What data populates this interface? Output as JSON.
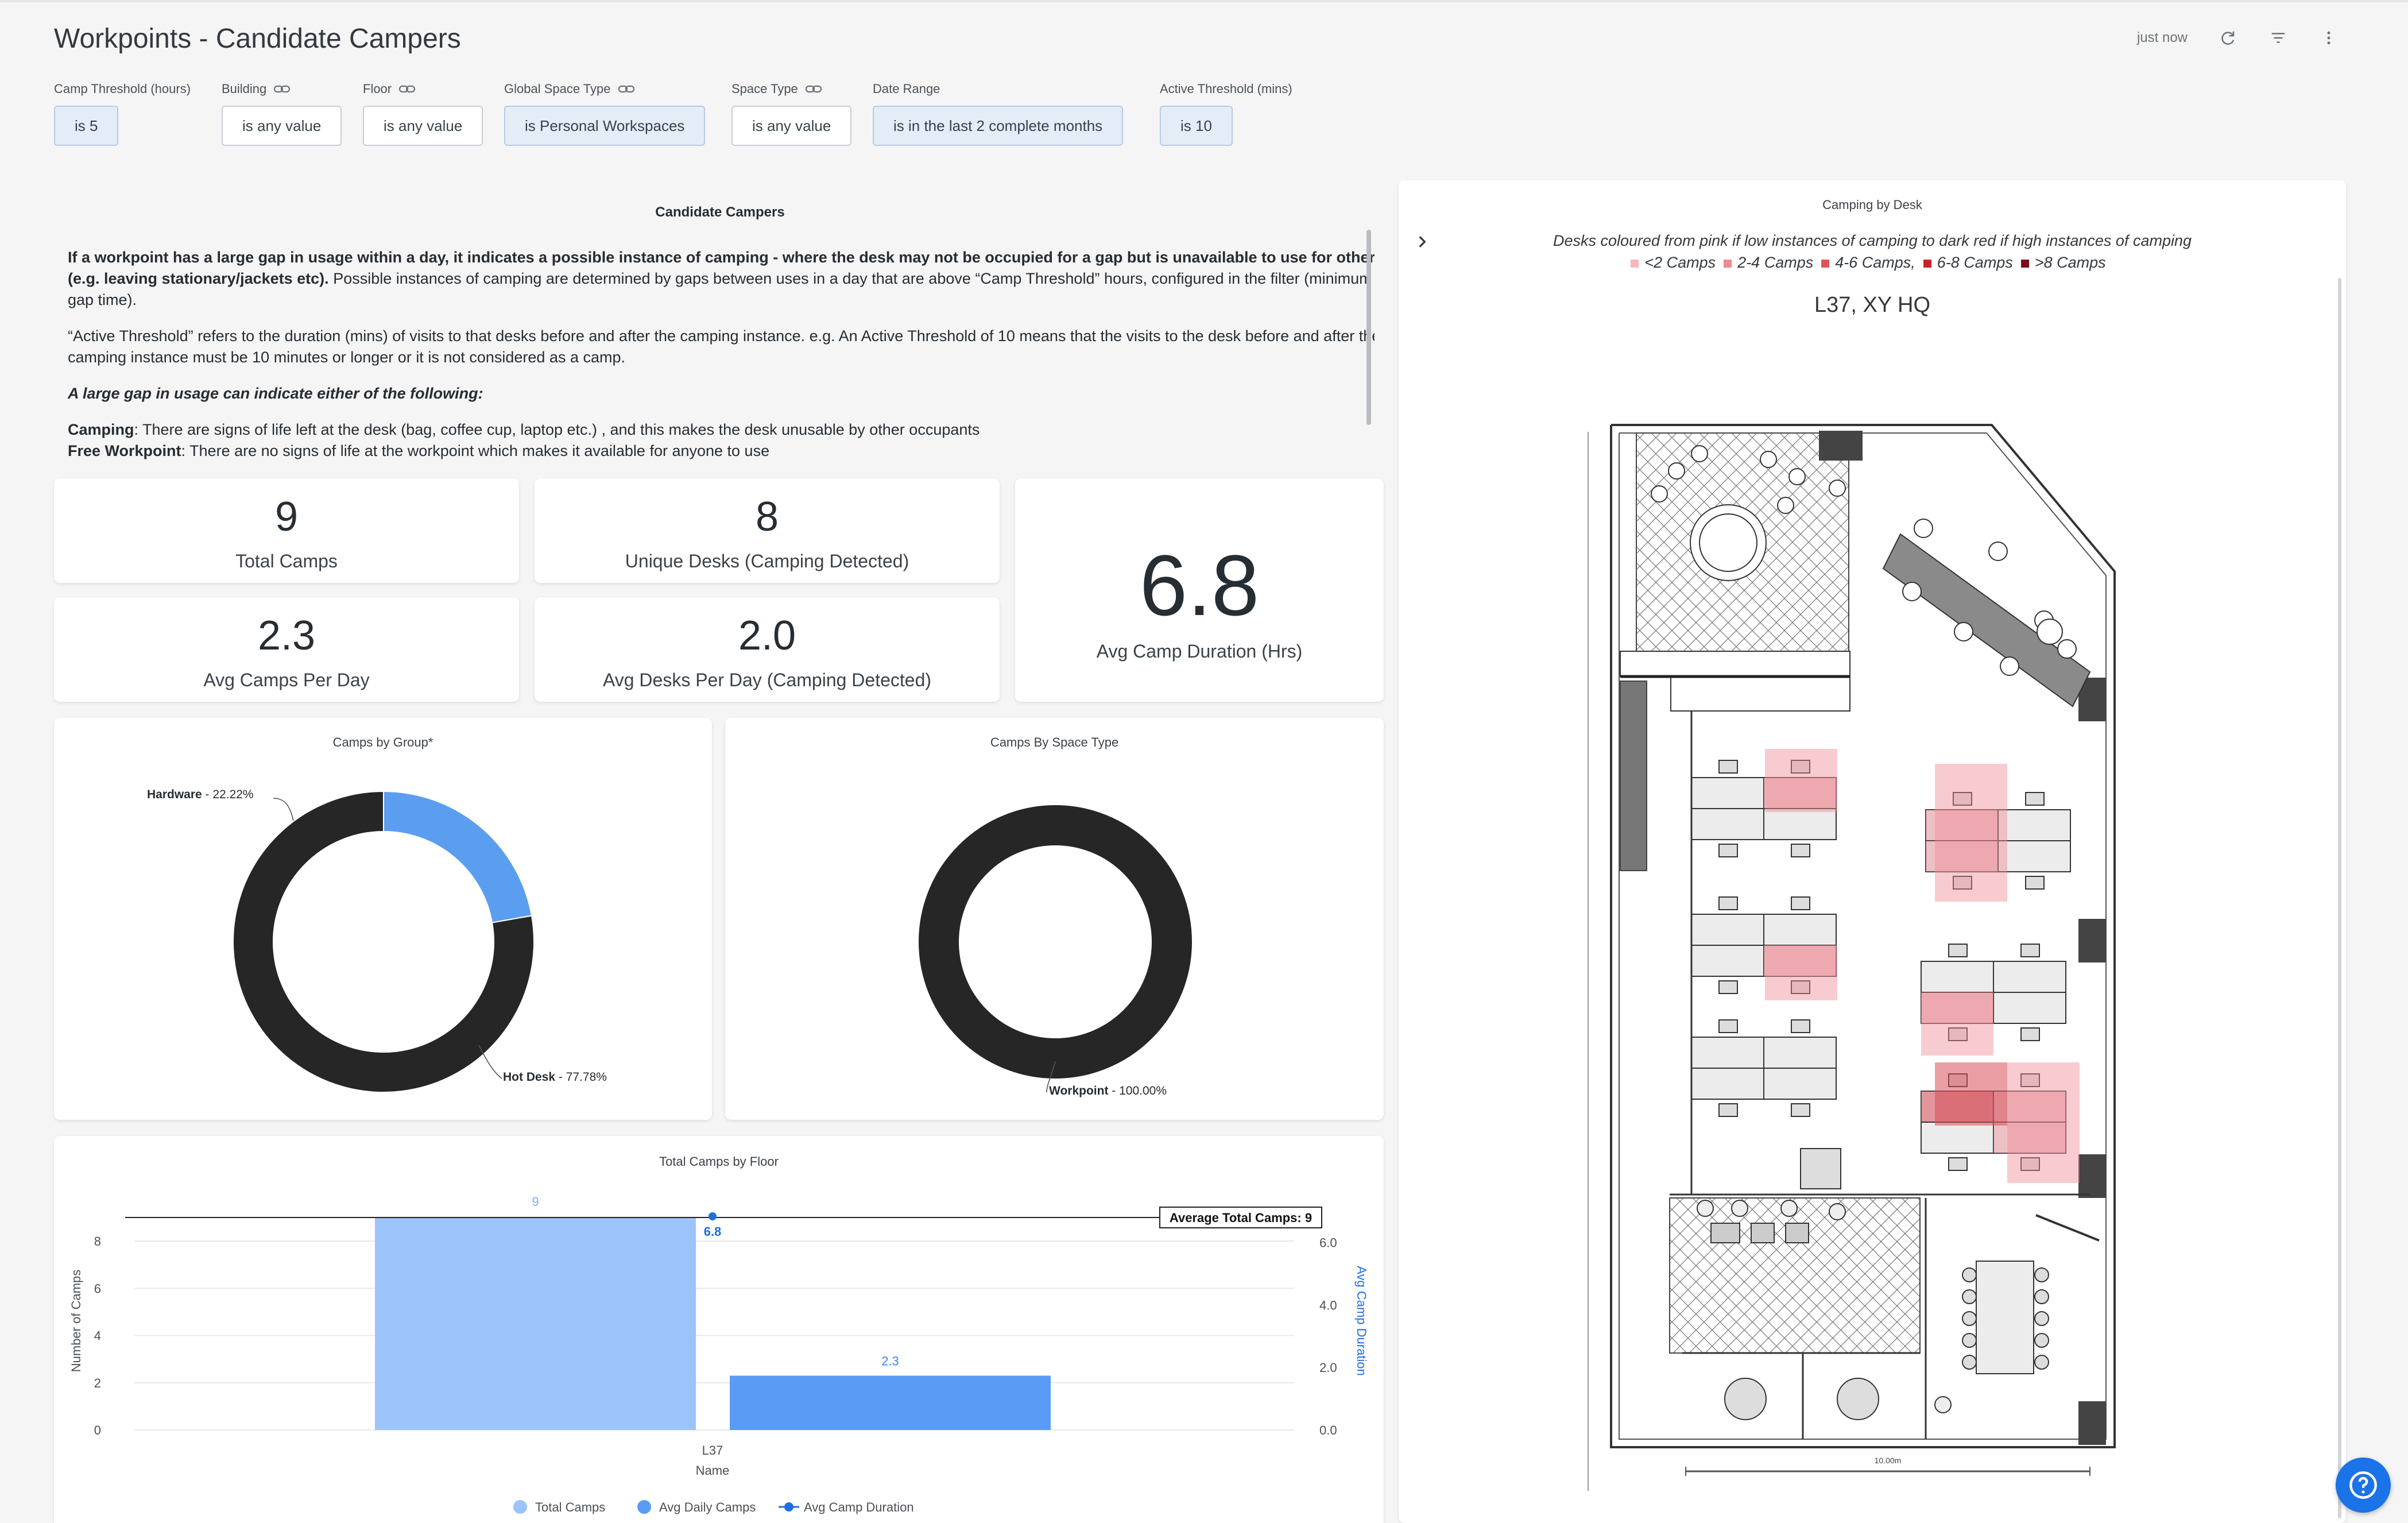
{
  "header": {
    "title": "Workpoints - Candidate Campers",
    "updated": "just now"
  },
  "filters": [
    {
      "label": "Camp Threshold (hours)",
      "value": "is 5",
      "active": true,
      "linked": false
    },
    {
      "label": "Building",
      "value": "is any value",
      "active": false,
      "linked": true
    },
    {
      "label": "Floor",
      "value": "is any value",
      "active": false,
      "linked": true
    },
    {
      "label": "Global Space Type",
      "value": "is Personal Workspaces",
      "active": true,
      "linked": true
    },
    {
      "label": "Space Type",
      "value": "is any value",
      "active": false,
      "linked": true
    },
    {
      "label": "Date Range",
      "value": "is in the last 2 complete months",
      "active": true,
      "linked": false
    },
    {
      "label": "Active Threshold (mins)",
      "value": "is 10",
      "active": true,
      "linked": false
    }
  ],
  "intro": {
    "title": "Candidate Campers",
    "p1_bold": "If a workpoint has a large gap in usage within a day, it indicates a possible instance of camping - where the desk may not be occupied for a gap but is unavailable to use for others (e.g. leaving stationary/jackets etc).",
    "p1_rest": " Possible instances of camping are determined by gaps between uses in a day that are above “Camp Threshold” hours, configured in the filter (minimum gap time).",
    "p2": "“Active Threshold” refers to the duration (mins) of visits to that desks before and after the camping instance. e.g. An Active Threshold of 10 means that the visits to the desk before and after the camping instance must be 10 minutes or longer or it is not considered as a camp.",
    "p3": "A large gap in usage can indicate either of the following:",
    "p4_bold": "Camping",
    "p4_rest": ": There are signs of life left at the desk (bag, coffee cup, laptop etc.) , and this makes the desk unusable by other occupants",
    "p5_bold": "Free Workpoint",
    "p5_rest": ": There are no signs of life at the workpoint which makes it available for anyone to use"
  },
  "kpis": {
    "total_camps": {
      "value": "9",
      "label": "Total Camps"
    },
    "unique_desks": {
      "value": "8",
      "label": "Unique Desks (Camping Detected)"
    },
    "avg_camps_day": {
      "value": "2.3",
      "label": "Avg Camps Per Day"
    },
    "avg_desks_day": {
      "value": "2.0",
      "label": "Avg Desks Per Day (Camping Detected)"
    },
    "avg_duration": {
      "value": "6.8",
      "label": "Avg Camp Duration (Hrs)"
    }
  },
  "donut_group": {
    "title": "Camps by Group*",
    "slices": [
      {
        "name": "Hardware",
        "pct_label": " - 22.22%",
        "value": 22.22,
        "color": "#5b9ef0"
      },
      {
        "name": "Hot Desk",
        "pct_label": " - 77.78%",
        "value": 77.78,
        "color": "#262626"
      }
    ]
  },
  "donut_space": {
    "title": "Camps By Space Type",
    "slices": [
      {
        "name": "Workpoint",
        "pct_label": " - 100.00%",
        "value": 100,
        "color": "#262626"
      }
    ]
  },
  "floor_chart": {
    "title": "Total Camps by Floor",
    "chart_data": {
      "type": "bar",
      "categories": [
        "L37"
      ],
      "series": [
        {
          "name": "Total Camps",
          "values": [
            9
          ],
          "color": "#9dc3fb",
          "axis": "left"
        },
        {
          "name": "Avg Daily Camps",
          "values": [
            2.3
          ],
          "color": "#5a9cf5",
          "axis": "left"
        },
        {
          "name": "Avg Camp Duration",
          "values": [
            6.8
          ],
          "color": "#1f6fe0",
          "axis": "right",
          "kind": "line"
        }
      ],
      "reference_line": {
        "label": "Average Total Camps: 9",
        "value": 9
      },
      "xlabel": "Name",
      "ylabel": "Number of Camps",
      "y2label": "Avg Camp Duration",
      "ylim": [
        0,
        9
      ],
      "yticks": [
        "0",
        "2",
        "4",
        "6",
        "8"
      ],
      "y2lim": [
        0,
        6.8
      ],
      "y2ticks": [
        "0.0",
        "2.0",
        "4.0",
        "6.0"
      ],
      "data_labels": [
        "9",
        "2.3",
        "6.8"
      ],
      "legend_position": "bottom"
    }
  },
  "map": {
    "title": "Camping by Desk",
    "subtitle": "Desks coloured from pink if low instances of camping to dark red if high instances of camping",
    "legend": [
      {
        "label": "<2 Camps",
        "color": "#f6b8bd"
      },
      {
        "label": "2-4 Camps",
        "color": "#ee8a90"
      },
      {
        "label": "4-6 Camps,",
        "color": "#e0555c"
      },
      {
        "label": "6-8 Camps",
        "color": "#c8232c"
      },
      {
        "label": ">8 Camps",
        "color": "#7a1117"
      }
    ],
    "floor_label": "L37, XY HQ",
    "scale_label": "10.00m"
  }
}
